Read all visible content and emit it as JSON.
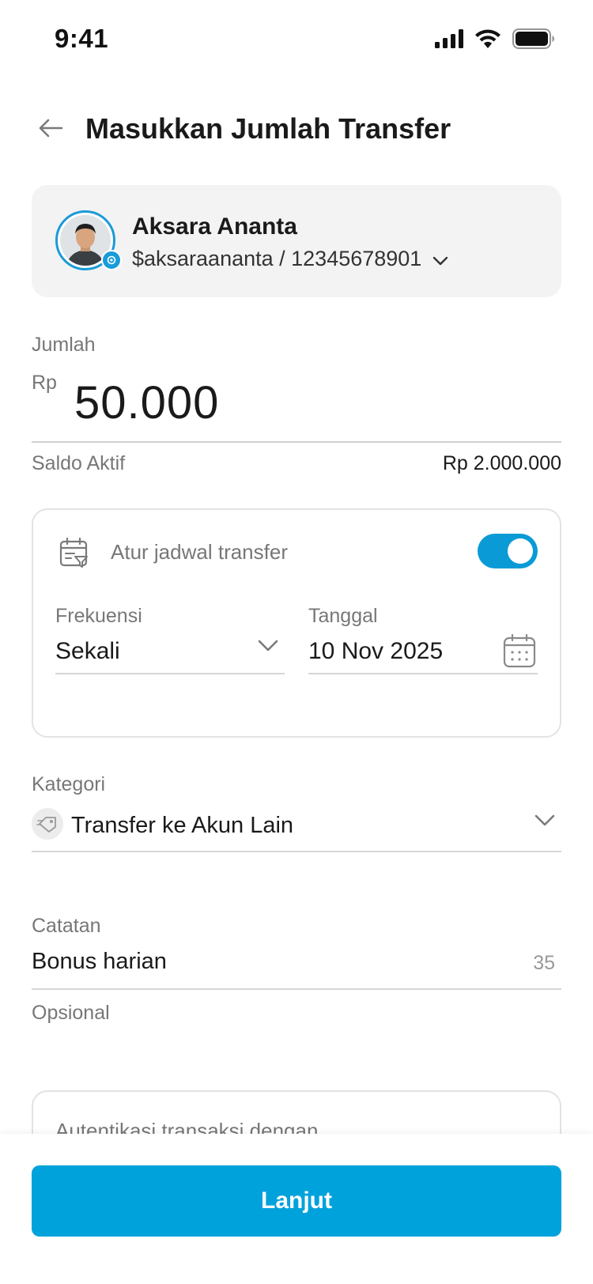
{
  "status_bar": {
    "time": "9:41",
    "icons": [
      "signal-icon",
      "wifi-icon",
      "battery-icon"
    ]
  },
  "header": {
    "title": "Masukkan Jumlah Transfer",
    "back_icon": "arrow-left-icon"
  },
  "recipient": {
    "name": "Aksara Ananta",
    "account": "$aksaraananta / 12345678901",
    "verified_badge_icon": "verified-badge-icon"
  },
  "amount": {
    "label": "Jumlah",
    "currency": "Rp",
    "value": "50.000",
    "balance_label": "Saldo Aktif",
    "balance_value": "Rp 2.000.000"
  },
  "schedule": {
    "label": "Atur jadwal transfer",
    "enabled": true,
    "frequency_label": "Frekuensi",
    "frequency_value": "Sekali",
    "date_label": "Tanggal",
    "date_value": "10 Nov 2025"
  },
  "category": {
    "label": "Kategori",
    "value": "Transfer ke Akun Lain"
  },
  "note": {
    "label": "Catatan",
    "value": "Bonus harian",
    "counter": "35",
    "helper": "Opsional"
  },
  "auth": {
    "text": "Autentikasi transaksi dengan"
  },
  "footer": {
    "button_label": "Lanjut"
  },
  "colors": {
    "accent": "#00a2dc",
    "toggle_on": "#0a9bd6",
    "card_bg": "#f3f3f3"
  }
}
